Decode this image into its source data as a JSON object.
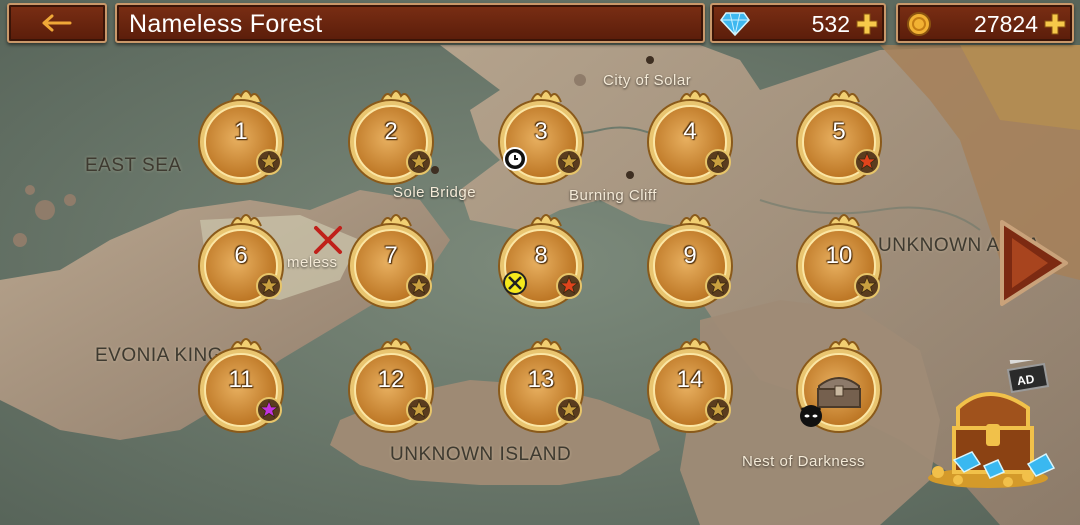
{
  "header": {
    "back_icon": "arrow-left-icon",
    "title": "Nameless Forest"
  },
  "resources": {
    "gems": {
      "icon": "diamond-icon",
      "value": "532"
    },
    "gold": {
      "icon": "coin-icon",
      "value": "27824"
    }
  },
  "map": {
    "labels": {
      "east_sea": "EAST SEA",
      "evonia": "EVONIA KING",
      "unknown_island": "UNKNOWN ISLAND",
      "unknown_area": "UNKNOWN AREA",
      "city_of_solar": "City of Solar",
      "sole_bridge": "Sole Bridge",
      "burning_cliff": "Burning Cliff",
      "nameless": "meless",
      "nest_of_darkness": "Nest of Darkness"
    }
  },
  "stages": [
    {
      "label": "1",
      "star": "gold"
    },
    {
      "label": "2",
      "star": "gold"
    },
    {
      "label": "3",
      "star": "gold",
      "extra": "clock-icon"
    },
    {
      "label": "4",
      "star": "gold"
    },
    {
      "label": "5",
      "star": "red"
    },
    {
      "label": "6",
      "star": "gold"
    },
    {
      "label": "7",
      "star": "gold"
    },
    {
      "label": "8",
      "star": "red",
      "extra": "swords-icon"
    },
    {
      "label": "9",
      "star": "gold"
    },
    {
      "label": "10",
      "star": "gold"
    },
    {
      "label": "11",
      "star": "purple"
    },
    {
      "label": "12",
      "star": "gold"
    },
    {
      "label": "13",
      "star": "gold"
    },
    {
      "label": "14",
      "star": "gold"
    },
    {
      "label": "",
      "icon": "treasure-chest-icon",
      "extra": "demon-icon"
    }
  ],
  "ad_chest": {
    "badge": "AD",
    "icon": "treasure-chest-icon"
  },
  "colors": {
    "bar": "#6a240e",
    "gold": "#d9a84a",
    "star_gold": "#c9a040",
    "star_red": "#e0441c",
    "star_purple": "#c233e0"
  }
}
